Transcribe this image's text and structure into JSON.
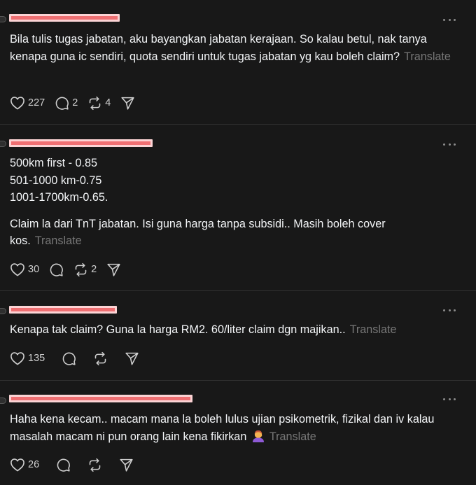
{
  "colors": {
    "background": "#181818",
    "divider": "#323232",
    "text": "#f3f5f7",
    "muted": "#777777",
    "redaction": "#ef6f72"
  },
  "translate_label": "Translate",
  "posts": [
    {
      "lines": [
        "Bila tulis tugas jabatan, aku bayangkan jabatan kerajaan. So kalau betul, nak tanya kenapa guna ic sendiri, quota sendiri untuk tugas jabatan yg kau boleh claim?"
      ],
      "likes": "227",
      "replies": "2",
      "reposts": "4"
    },
    {
      "lines": [
        "500km first - 0.85",
        "501-1000 km-0.75",
        "1001-1700km-0.65."
      ],
      "paragraph2": "Claim la dari TnT jabatan. Isi guna harga tanpa subsidi.. Masih boleh cover kos.",
      "likes": "30",
      "replies": "",
      "reposts": "2"
    },
    {
      "lines": [
        "Kenapa tak claim? Guna la harga RM2. 60/liter claim dgn majikan.."
      ],
      "likes": "135",
      "replies": "",
      "reposts": ""
    },
    {
      "lines": [
        "Haha kena kecam.. macam mana la boleh lulus ujian psikometrik, fizikal dan iv kalau masalah macam ni pun orang lain kena fikirkan"
      ],
      "emoji": "person-facepalming-emoji",
      "likes": "26",
      "replies": "",
      "reposts": ""
    }
  ]
}
